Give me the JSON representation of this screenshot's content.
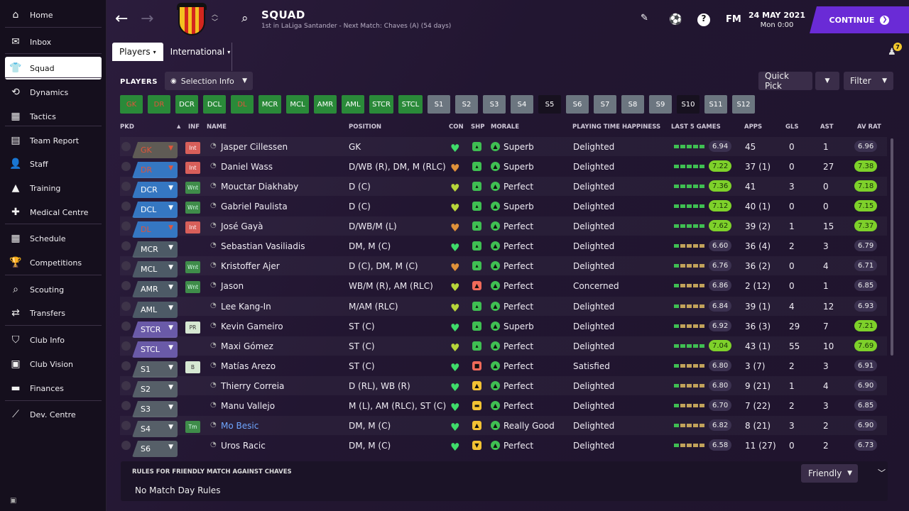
{
  "sidebar": {
    "items": [
      {
        "label": "Home",
        "icon": "⌂",
        "name": "home"
      },
      {
        "label": "Inbox",
        "icon": "✉",
        "name": "inbox"
      },
      {
        "label": "Squad",
        "icon": "👕",
        "name": "squad",
        "active": true
      },
      {
        "label": "Dynamics",
        "icon": "⟲",
        "name": "dynamics"
      },
      {
        "label": "Tactics",
        "icon": "▦",
        "name": "tactics"
      },
      {
        "label": "Team Report",
        "icon": "▤",
        "name": "team-report"
      },
      {
        "label": "Staff",
        "icon": "👤",
        "name": "staff"
      },
      {
        "label": "Training",
        "icon": "▲",
        "name": "training"
      },
      {
        "label": "Medical Centre",
        "icon": "✚",
        "name": "medical-centre"
      },
      {
        "label": "Schedule",
        "icon": "▦",
        "name": "schedule"
      },
      {
        "label": "Competitions",
        "icon": "🏆",
        "name": "competitions"
      },
      {
        "label": "Scouting",
        "icon": "⌕",
        "name": "scouting"
      },
      {
        "label": "Transfers",
        "icon": "⇄",
        "name": "transfers"
      },
      {
        "label": "Club Info",
        "icon": "⛉",
        "name": "club-info"
      },
      {
        "label": "Club Vision",
        "icon": "▣",
        "name": "club-vision"
      },
      {
        "label": "Finances",
        "icon": "▬",
        "name": "finances"
      },
      {
        "label": "Dev. Centre",
        "icon": "⟋",
        "name": "dev-centre"
      }
    ]
  },
  "header": {
    "title": "SQUAD",
    "subtitle": "1st in LaLiga Santander - Next Match: Chaves (A) (54 days)",
    "fm": "FM",
    "date": "24 MAY 2021",
    "time": "Mon 0:00",
    "continue": "CONTINUE",
    "notif_count": "7"
  },
  "tabs": [
    "Players",
    "International"
  ],
  "toolbar": {
    "players": "PLAYERS",
    "selection_info": "Selection Info",
    "quick_pick": "Quick Pick",
    "filter": "Filter"
  },
  "positions": [
    "GK",
    "DR",
    "DCR",
    "DCL",
    "DL",
    "MCR",
    "MCL",
    "AMR",
    "AML",
    "STCR",
    "STCL",
    "S1",
    "S2",
    "S3",
    "S4",
    "S5",
    "S6",
    "S7",
    "S8",
    "S9",
    "S10",
    "S11",
    "S12"
  ],
  "columns": {
    "pkd": "PKD",
    "inf": "INF",
    "name": "NAME",
    "position": "POSITION",
    "con": "CON",
    "shp": "SHP",
    "morale": "MORALE",
    "pth": "PLAYING TIME HAPPINESS",
    "last5": "LAST 5 GAMES",
    "apps": "APPS",
    "gls": "GLS",
    "ast": "AST",
    "avrat": "AV RAT"
  },
  "rows": [
    {
      "pkd": "GK",
      "inf": "Int",
      "name": "Jasper Cillessen",
      "position": "GK",
      "morale": "Superb",
      "pth": "Delighted",
      "l5": "6.94",
      "apps": "45",
      "gls": "0",
      "ast": "1",
      "avrat": "6.96"
    },
    {
      "pkd": "DR",
      "inf": "Int",
      "name": "Daniel Wass",
      "position": "D/WB (R), DM, M (RLC)",
      "morale": "Superb",
      "pth": "Delighted",
      "l5": "7.22",
      "apps": "37 (1)",
      "gls": "0",
      "ast": "27",
      "avrat": "7.38"
    },
    {
      "pkd": "DCR",
      "inf": "Wnt",
      "name": "Mouctar Diakhaby",
      "position": "D (C)",
      "morale": "Perfect",
      "pth": "Delighted",
      "l5": "7.36",
      "apps": "41",
      "gls": "3",
      "ast": "0",
      "avrat": "7.18"
    },
    {
      "pkd": "DCL",
      "inf": "Wnt",
      "name": "Gabriel Paulista",
      "position": "D (C)",
      "morale": "Superb",
      "pth": "Delighted",
      "l5": "7.12",
      "apps": "40 (1)",
      "gls": "0",
      "ast": "0",
      "avrat": "7.15"
    },
    {
      "pkd": "DL",
      "inf": "Int",
      "name": "José Gayà",
      "position": "D/WB/M (L)",
      "morale": "Perfect",
      "pth": "Delighted",
      "l5": "7.62",
      "apps": "39 (2)",
      "gls": "1",
      "ast": "15",
      "avrat": "7.37"
    },
    {
      "pkd": "MCR",
      "inf": "",
      "name": "Sebastian Vasiliadis",
      "position": "DM, M (C)",
      "morale": "Perfect",
      "pth": "Delighted",
      "l5": "6.60",
      "apps": "36 (4)",
      "gls": "2",
      "ast": "3",
      "avrat": "6.79"
    },
    {
      "pkd": "MCL",
      "inf": "Wnt",
      "name": "Kristoffer Ajer",
      "position": "D (C), DM, M (C)",
      "morale": "Perfect",
      "pth": "Delighted",
      "l5": "6.76",
      "apps": "36 (2)",
      "gls": "0",
      "ast": "4",
      "avrat": "6.71"
    },
    {
      "pkd": "AMR",
      "inf": "Wnt",
      "name": "Jason",
      "position": "WB/M (R), AM (RLC)",
      "morale": "Perfect",
      "pth": "Concerned",
      "l5": "6.86",
      "apps": "2 (12)",
      "gls": "0",
      "ast": "1",
      "avrat": "6.85"
    },
    {
      "pkd": "AML",
      "inf": "",
      "name": "Lee Kang-In",
      "position": "M/AM (RLC)",
      "morale": "Perfect",
      "pth": "Delighted",
      "l5": "6.84",
      "apps": "39 (1)",
      "gls": "4",
      "ast": "12",
      "avrat": "6.93"
    },
    {
      "pkd": "STCR",
      "inf": "PR",
      "name": "Kevin Gameiro",
      "position": "ST (C)",
      "morale": "Superb",
      "pth": "Delighted",
      "l5": "6.92",
      "apps": "36 (3)",
      "gls": "29",
      "ast": "7",
      "avrat": "7.21"
    },
    {
      "pkd": "STCL",
      "inf": "",
      "name": "Maxi Gómez",
      "position": "ST (C)",
      "morale": "Perfect",
      "pth": "Delighted",
      "l5": "7.04",
      "apps": "43 (1)",
      "gls": "55",
      "ast": "10",
      "avrat": "7.69"
    },
    {
      "pkd": "S1",
      "inf": "B",
      "name": "Matías Arezo",
      "position": "ST (C)",
      "morale": "Perfect",
      "pth": "Satisfied",
      "l5": "6.80",
      "apps": "3 (7)",
      "gls": "2",
      "ast": "3",
      "avrat": "6.91"
    },
    {
      "pkd": "S2",
      "inf": "",
      "name": "Thierry Correia",
      "position": "D (RL), WB (R)",
      "morale": "Perfect",
      "pth": "Delighted",
      "l5": "6.80",
      "apps": "9 (21)",
      "gls": "1",
      "ast": "4",
      "avrat": "6.90"
    },
    {
      "pkd": "S3",
      "inf": "",
      "name": "Manu Vallejo",
      "position": "M (L), AM (RLC), ST (C)",
      "morale": "Perfect",
      "pth": "Delighted",
      "l5": "6.70",
      "apps": "7 (22)",
      "gls": "2",
      "ast": "3",
      "avrat": "6.85"
    },
    {
      "pkd": "S4",
      "inf": "Tm",
      "name": "Mo Besic",
      "position": "DM, M (C)",
      "morale": "Really Good",
      "pth": "Delighted",
      "l5": "6.82",
      "apps": "8 (21)",
      "gls": "3",
      "ast": "2",
      "avrat": "6.90"
    },
    {
      "pkd": "S6",
      "inf": "",
      "name": "Uros Racic",
      "position": "DM, M (C)",
      "morale": "Perfect",
      "pth": "Delighted",
      "l5": "6.58",
      "apps": "11 (27)",
      "gls": "0",
      "ast": "2",
      "avrat": "6.73"
    }
  ],
  "rules": {
    "title": "RULES FOR FRIENDLY MATCH AGAINST CHAVES",
    "value": "No Match Day Rules",
    "friendly": "Friendly"
  },
  "colors": {
    "accent": "#6a2bd6",
    "green": "#2a8a39",
    "rating_good": "#7ed12a"
  }
}
